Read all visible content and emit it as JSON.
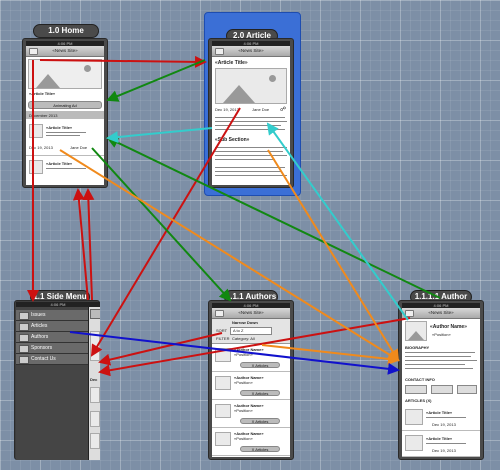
{
  "tags": {
    "home": "1.0  Home",
    "article": "2.0 Article",
    "side_menu": "1.1 Side Menu",
    "authors": "1.1.1 Authors",
    "author": "1.1.1.1 Author"
  },
  "status_time": "4:06 PM",
  "nav_title": "«News Site»",
  "home": {
    "ad_banner": "Animating Ad",
    "section": "December 2013",
    "article_title_1": "«Article Title»",
    "article_title_2": "«Article Title»",
    "article_title_3": "«Article Title»",
    "date": "Dec 19, 2013",
    "author_name": "Jane Doe"
  },
  "article": {
    "title": "«Article Title»",
    "date": "Dec 19, 2013",
    "author_name": "Jane Doe",
    "sub_section": "«Sub Section»"
  },
  "side_menu": {
    "items": [
      "Issues",
      "Articles",
      "Authors",
      "Sponsors",
      "Contact Us"
    ],
    "partial_labels": [
      "Dec"
    ]
  },
  "authors": {
    "narrow": "Narrow Down",
    "sort_label": "SORT",
    "sort_value": "A to Z",
    "filter_label": "FILTER",
    "filter_value": "Category: All",
    "author_name": "«Author Name»",
    "position": "«Position»",
    "articles_button": "X Articles"
  },
  "author": {
    "name": "«Author Name»",
    "position": "«Position»",
    "biography": "BIOGRAPHY",
    "contact": "CONTACT INFO",
    "articles": "ARTICLES (X)",
    "article_title": "«Article Title»",
    "date": "Dec 19, 2013"
  },
  "colors": {
    "red": "#cc1111",
    "green": "#118811",
    "cyan": "#33cccc",
    "orange": "#f08a1c",
    "blue": "#1111cc",
    "highlight": "#3b6fd6"
  }
}
